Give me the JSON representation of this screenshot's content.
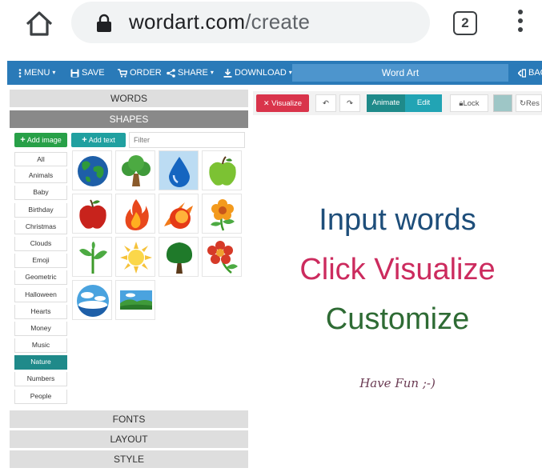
{
  "browser": {
    "url_host": "wordart.com",
    "url_path": "/create",
    "tab_count": "2"
  },
  "nav": {
    "menu": "MENU",
    "save": "SAVE",
    "order": "ORDER",
    "share": "SHARE",
    "download": "DOWNLOAD",
    "title": "Word Art",
    "back": "BAC"
  },
  "sidebar": {
    "words": "WORDS",
    "shapes": "SHAPES",
    "add_image": "Add image",
    "add_text": "Add text",
    "filter_placeholder": "Filter",
    "categories": [
      "All",
      "Animals",
      "Baby",
      "Birthday",
      "Christmas",
      "Clouds",
      "Emoji",
      "Geometric",
      "Halloween",
      "Hearts",
      "Money",
      "Music",
      "Nature",
      "Numbers",
      "People"
    ],
    "selected_category": "Nature",
    "shapes_list": [
      "earth",
      "tree",
      "water-drop",
      "green-apple",
      "red-apple",
      "fire",
      "fireball",
      "flower",
      "sprout",
      "sun",
      "tree",
      "red-flower",
      "sky",
      "landscape"
    ],
    "fonts": "FONTS",
    "layout": "LAYOUT",
    "style": "STYLE"
  },
  "toolbar": {
    "visualize": "Visualize",
    "animate": "Animate",
    "edit": "Edit",
    "lock": "Lock",
    "reset": "Res"
  },
  "canvas": {
    "line1": "Input words",
    "line2": "Click Visualize",
    "line3": "Customize",
    "line4": "Have Fun ;-)"
  },
  "colors": {
    "nav_blue": "#2a7ab8",
    "visualize_red": "#d9344b",
    "animate_teal": "#1f8a8a",
    "add_image_green": "#28a048",
    "line1_color": "#1e4e7a",
    "line2_color": "#cc2b5e",
    "line3_color": "#2e6b34",
    "line4_color": "#6a3a52"
  }
}
